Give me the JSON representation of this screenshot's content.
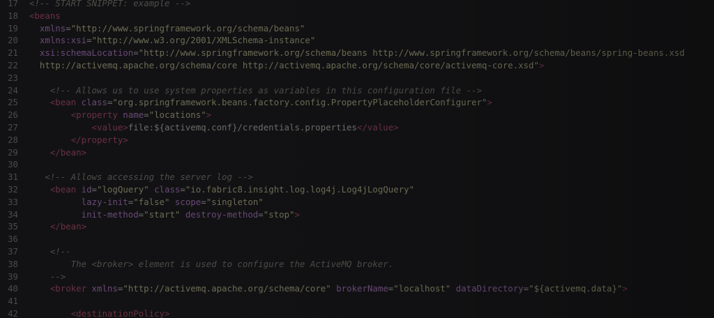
{
  "editor": {
    "lines": [
      {
        "num": "17",
        "tokens": [
          {
            "t": "<!-- START SNIPPET: example -->",
            "k": "comment"
          }
        ]
      },
      {
        "num": "18",
        "tokens": [
          {
            "t": "<beans",
            "k": "tag"
          }
        ]
      },
      {
        "num": "19",
        "tokens": [
          {
            "t": "  ",
            "k": "plain"
          },
          {
            "t": "xmlns",
            "k": "attr"
          },
          {
            "t": "=",
            "k": "punct"
          },
          {
            "t": "\"http://www.springframework.org/schema/beans\"",
            "k": "string"
          }
        ]
      },
      {
        "num": "20",
        "tokens": [
          {
            "t": "  ",
            "k": "plain"
          },
          {
            "t": "xmlns:xsi",
            "k": "attr"
          },
          {
            "t": "=",
            "k": "punct"
          },
          {
            "t": "\"http://www.w3.org/2001/XMLSchema-instance\"",
            "k": "string"
          }
        ]
      },
      {
        "num": "21",
        "tokens": [
          {
            "t": "  ",
            "k": "plain"
          },
          {
            "t": "xsi:schemaLocation",
            "k": "attr"
          },
          {
            "t": "=",
            "k": "punct"
          },
          {
            "t": "\"http://www.springframework.org/schema/beans http://www.springframework.org/schema/beans/spring-beans.xsd",
            "k": "string"
          }
        ]
      },
      {
        "num": "22",
        "tokens": [
          {
            "t": "  http://activemq.apache.org/schema/core http://activemq.apache.org/schema/core/activemq-core.xsd\"",
            "k": "string"
          },
          {
            "t": ">",
            "k": "tag"
          }
        ]
      },
      {
        "num": "23",
        "tokens": []
      },
      {
        "num": "24",
        "tokens": [
          {
            "t": "    ",
            "k": "plain"
          },
          {
            "t": "<!-- Allows us to use system properties as variables in this configuration file -->",
            "k": "comment"
          }
        ]
      },
      {
        "num": "25",
        "tokens": [
          {
            "t": "    ",
            "k": "plain"
          },
          {
            "t": "<bean",
            "k": "tag"
          },
          {
            "t": " ",
            "k": "plain"
          },
          {
            "t": "class",
            "k": "attr"
          },
          {
            "t": "=",
            "k": "punct"
          },
          {
            "t": "\"org.springframework.beans.factory.config.PropertyPlaceholderConfigurer\"",
            "k": "string"
          },
          {
            "t": ">",
            "k": "tag"
          }
        ]
      },
      {
        "num": "26",
        "tokens": [
          {
            "t": "        ",
            "k": "plain"
          },
          {
            "t": "<property",
            "k": "tag"
          },
          {
            "t": " ",
            "k": "plain"
          },
          {
            "t": "name",
            "k": "attr"
          },
          {
            "t": "=",
            "k": "punct"
          },
          {
            "t": "\"locations\"",
            "k": "string"
          },
          {
            "t": ">",
            "k": "tag"
          }
        ]
      },
      {
        "num": "27",
        "tokens": [
          {
            "t": "            ",
            "k": "plain"
          },
          {
            "t": "<value>",
            "k": "tag"
          },
          {
            "t": "file:${activemq.conf}/credentials.properties",
            "k": "plain"
          },
          {
            "t": "</value>",
            "k": "tag"
          }
        ]
      },
      {
        "num": "28",
        "tokens": [
          {
            "t": "        ",
            "k": "plain"
          },
          {
            "t": "</property>",
            "k": "tag"
          }
        ]
      },
      {
        "num": "29",
        "tokens": [
          {
            "t": "    ",
            "k": "plain"
          },
          {
            "t": "</bean>",
            "k": "tag"
          }
        ]
      },
      {
        "num": "30",
        "tokens": []
      },
      {
        "num": "31",
        "tokens": [
          {
            "t": "   ",
            "k": "plain"
          },
          {
            "t": "<!-- Allows accessing the server log -->",
            "k": "comment"
          }
        ]
      },
      {
        "num": "32",
        "tokens": [
          {
            "t": "    ",
            "k": "plain"
          },
          {
            "t": "<bean",
            "k": "tag"
          },
          {
            "t": " ",
            "k": "plain"
          },
          {
            "t": "id",
            "k": "attr"
          },
          {
            "t": "=",
            "k": "punct"
          },
          {
            "t": "\"logQuery\"",
            "k": "string"
          },
          {
            "t": " ",
            "k": "plain"
          },
          {
            "t": "class",
            "k": "attr"
          },
          {
            "t": "=",
            "k": "punct"
          },
          {
            "t": "\"io.fabric8.insight.log.log4j.Log4jLogQuery\"",
            "k": "string"
          }
        ]
      },
      {
        "num": "33",
        "tokens": [
          {
            "t": "          ",
            "k": "plain"
          },
          {
            "t": "lazy-init",
            "k": "attr"
          },
          {
            "t": "=",
            "k": "punct"
          },
          {
            "t": "\"false\"",
            "k": "string"
          },
          {
            "t": " ",
            "k": "plain"
          },
          {
            "t": "scope",
            "k": "attr"
          },
          {
            "t": "=",
            "k": "punct"
          },
          {
            "t": "\"singleton\"",
            "k": "string"
          }
        ]
      },
      {
        "num": "34",
        "tokens": [
          {
            "t": "          ",
            "k": "plain"
          },
          {
            "t": "init-method",
            "k": "attr"
          },
          {
            "t": "=",
            "k": "punct"
          },
          {
            "t": "\"start\"",
            "k": "string"
          },
          {
            "t": " ",
            "k": "plain"
          },
          {
            "t": "destroy-method",
            "k": "attr"
          },
          {
            "t": "=",
            "k": "punct"
          },
          {
            "t": "\"stop\"",
            "k": "string"
          },
          {
            "t": ">",
            "k": "tag"
          }
        ]
      },
      {
        "num": "35",
        "tokens": [
          {
            "t": "    ",
            "k": "plain"
          },
          {
            "t": "</bean>",
            "k": "tag"
          }
        ]
      },
      {
        "num": "36",
        "tokens": []
      },
      {
        "num": "37",
        "tokens": [
          {
            "t": "    ",
            "k": "plain"
          },
          {
            "t": "<!--",
            "k": "comment"
          }
        ]
      },
      {
        "num": "38",
        "tokens": [
          {
            "t": "        The <broker> element is used to configure the ActiveMQ broker.",
            "k": "comment"
          }
        ]
      },
      {
        "num": "39",
        "tokens": [
          {
            "t": "    ",
            "k": "plain"
          },
          {
            "t": "-->",
            "k": "comment"
          }
        ]
      },
      {
        "num": "40",
        "tokens": [
          {
            "t": "    ",
            "k": "plain"
          },
          {
            "t": "<broker",
            "k": "tag"
          },
          {
            "t": " ",
            "k": "plain"
          },
          {
            "t": "xmlns",
            "k": "attr"
          },
          {
            "t": "=",
            "k": "punct"
          },
          {
            "t": "\"http://activemq.apache.org/schema/core\"",
            "k": "string"
          },
          {
            "t": " ",
            "k": "plain"
          },
          {
            "t": "brokerName",
            "k": "attr"
          },
          {
            "t": "=",
            "k": "punct"
          },
          {
            "t": "\"localhost\"",
            "k": "string"
          },
          {
            "t": " ",
            "k": "plain"
          },
          {
            "t": "dataDirectory",
            "k": "attr"
          },
          {
            "t": "=",
            "k": "punct"
          },
          {
            "t": "\"${activemq.data}\"",
            "k": "string"
          },
          {
            "t": ">",
            "k": "tag"
          }
        ]
      },
      {
        "num": "41",
        "tokens": []
      },
      {
        "num": "42",
        "tokens": [
          {
            "t": "        ",
            "k": "plain"
          },
          {
            "t": "<destinationPolicy>",
            "k": "tag"
          }
        ]
      }
    ]
  }
}
